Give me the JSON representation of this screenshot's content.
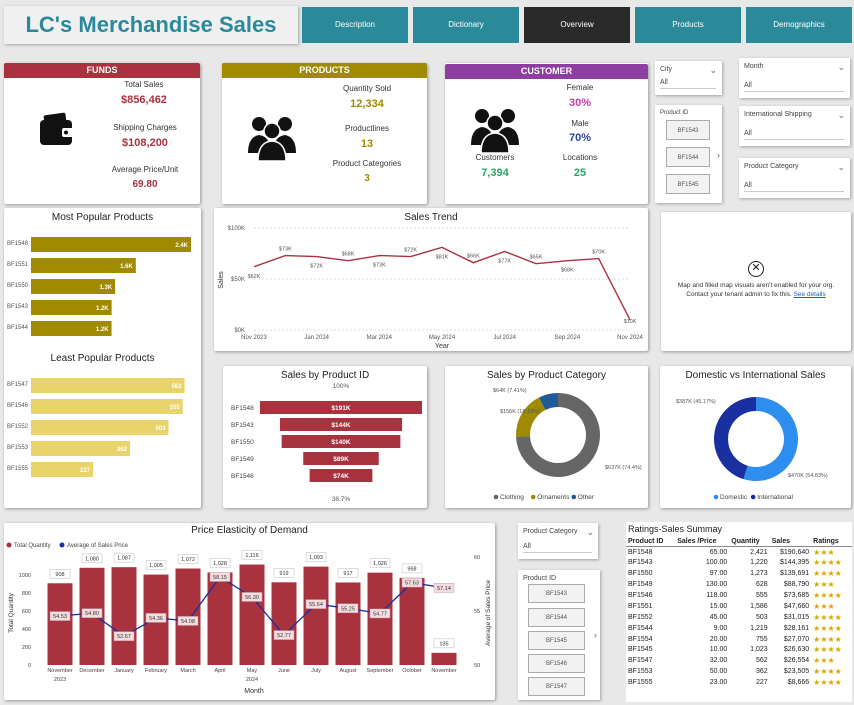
{
  "app_title": "LC's Merchandise Sales",
  "tabs": [
    {
      "label": "Description"
    },
    {
      "label": "Dictionary"
    },
    {
      "label": "Overview"
    },
    {
      "label": "Products"
    },
    {
      "label": "Demographics"
    }
  ],
  "colors": {
    "teal": "#2b8a9a",
    "funds": "#a8323e",
    "products": "#a08a00",
    "customer": "#8e3da0",
    "maroon": "#a8323e"
  },
  "funds": {
    "header": "FUNDS",
    "total_sales_label": "Total Sales",
    "total_sales": "$856,462",
    "shipping_label": "Shipping Charges",
    "shipping": "$108,200",
    "avg_price_label": "Average Price/Unit",
    "avg_price": "69.80",
    "icon": "wallet-icon"
  },
  "products": {
    "header": "PRODUCTS",
    "qty_label": "Quantity Sold",
    "qty": "12,334",
    "lines_label": "Productlines",
    "lines": "13",
    "cats_label": "Product Categories",
    "cats": "3",
    "icon": "people-group-icon"
  },
  "customer": {
    "header": "CUSTOMER",
    "female_label": "Female",
    "female": "30%",
    "male_label": "Male",
    "male": "70%",
    "customers_label": "Customers",
    "customers": "7,394",
    "locations_label": "Locations",
    "locations": "25",
    "icon": "people-group-icon"
  },
  "slicers": {
    "city": {
      "label": "City",
      "value": "All"
    },
    "month": {
      "label": "Month",
      "value": "All"
    },
    "product_id": {
      "label": "Product ID",
      "items": [
        "BF1543",
        "BF1544",
        "BF1545"
      ]
    },
    "intl_shipping": {
      "label": "International Shipping",
      "value": "All"
    },
    "product_category": {
      "label": "Product Category",
      "value": "All"
    },
    "product_category2": {
      "label": "Product Category",
      "value": "All"
    },
    "product_id2": {
      "label": "Product ID",
      "items": [
        "BF1543",
        "BF1544",
        "BF1545",
        "BF1546",
        "BF1547"
      ]
    }
  },
  "map_notice": {
    "text": "Map and filled map visuals aren't enabled for your org. Contact your tenant admin to fix this.",
    "link": "See details"
  },
  "ratings_table": {
    "title": "Ratings-Sales Summay",
    "headers": [
      "Product ID",
      "Sales /Price",
      "Quantity",
      "Sales",
      "Ratings"
    ],
    "rows": [
      [
        "BF1548",
        "65.00",
        "2,421",
        "$190,640",
        "★★★"
      ],
      [
        "BF1543",
        "100.00",
        "1,220",
        "$144,395",
        "★★★★"
      ],
      [
        "BF1550",
        "97.00",
        "1,273",
        "$139,691",
        "★★★★"
      ],
      [
        "BF1549",
        "130.00",
        "628",
        "$88,790",
        "★★★"
      ],
      [
        "BF1546",
        "118.00",
        "555",
        "$73,685",
        "★★★★"
      ],
      [
        "BF1551",
        "15.00",
        "1,586",
        "$47,660",
        "★★★"
      ],
      [
        "BF1552",
        "45.00",
        "503",
        "$31,015",
        "★★★★"
      ],
      [
        "BF1544",
        "9.00",
        "1,219",
        "$28,161",
        "★★★★"
      ],
      [
        "BF1554",
        "20.00",
        "755",
        "$27,070",
        "★★★★"
      ],
      [
        "BF1545",
        "10.00",
        "1,023",
        "$26,630",
        "★★★★"
      ],
      [
        "BF1547",
        "32.00",
        "562",
        "$26,554",
        "★★★"
      ],
      [
        "BF1553",
        "50.00",
        "362",
        "$23,505",
        "★★★★"
      ],
      [
        "BF1555",
        "23.00",
        "227",
        "$8,666",
        "★★★★"
      ]
    ]
  },
  "chart_data": [
    {
      "id": "most_popular",
      "type": "bar",
      "title": "Most Popular Products",
      "categories": [
        "BF1548",
        "BF1551",
        "BF1550",
        "BF1543",
        "BF1544"
      ],
      "values": [
        2421,
        1586,
        1273,
        1220,
        1219
      ],
      "labels": [
        "2.4K",
        "1.6K",
        "1.3K",
        "1.2K",
        "1.2K"
      ]
    },
    {
      "id": "least_popular",
      "type": "bar",
      "title": "Least Popular Products",
      "categories": [
        "BF1547",
        "BF1546",
        "BF1552",
        "BF1553",
        "BF1555"
      ],
      "values": [
        562,
        555,
        503,
        362,
        227
      ],
      "labels": [
        "562",
        "555",
        "503",
        "362",
        "227"
      ]
    },
    {
      "id": "sales_trend",
      "type": "line",
      "title": "Sales Trend",
      "xlabel": "Year",
      "ylabel": "Sales",
      "x": [
        "Nov 2023",
        "Dec 2023",
        "Jan 2024",
        "Feb 2024",
        "Mar 2024",
        "Apr 2024",
        "May 2024",
        "Jun 2024",
        "Jul 2024",
        "Aug 2024",
        "Sep 2024",
        "Oct 2024",
        "Nov 2024"
      ],
      "values": [
        62,
        73,
        72,
        68,
        73,
        72,
        81,
        66,
        77,
        65,
        68,
        70,
        10
      ],
      "labels": [
        "$62K",
        "$73K",
        "$72K",
        "$68K",
        "$73K",
        "$72K",
        "$81K",
        "$66K",
        "$77K",
        "$65K",
        "$68K",
        "$70K",
        "$10K"
      ],
      "xticks": [
        "Nov 2023",
        "Jan 2024",
        "Mar 2024",
        "May 2024",
        "Jul 2024",
        "Sep 2024",
        "Nov 2024"
      ],
      "yticks": [
        "$100K",
        "$50K",
        "$0K"
      ],
      "ylim": [
        0,
        100
      ]
    },
    {
      "id": "sales_by_product",
      "type": "bar",
      "title": "Sales by Product ID",
      "categories": [
        "BF1548",
        "BF1543",
        "BF1550",
        "BF1549",
        "BF1546"
      ],
      "values": [
        191,
        144,
        140,
        89,
        74
      ],
      "labels": [
        "$191K",
        "$144K",
        "$140K",
        "$89K",
        "$74K"
      ],
      "top_pct": "100%",
      "bottom_pct": "38.7%"
    },
    {
      "id": "sales_by_category",
      "type": "pie",
      "title": "Sales by Product Category",
      "series": [
        {
          "name": "Clothing",
          "value": 637,
          "label": "$637K (74.4%)",
          "color": "#666666"
        },
        {
          "name": "Ornaments",
          "value": 156,
          "label": "$156K (18.19%)",
          "color": "#a08a00"
        },
        {
          "name": "Other",
          "value": 64,
          "label": "$64K (7.41%)",
          "color": "#1f5a9a"
        }
      ]
    },
    {
      "id": "domestic_intl",
      "type": "pie",
      "title": "Domestic vs International Sales",
      "series": [
        {
          "name": "Domestic",
          "value": 470,
          "label": "$470K (54.83%)",
          "color": "#2e8ef0"
        },
        {
          "name": "International",
          "value": 387,
          "label": "$387K (45.17%)",
          "color": "#1a2fa0"
        }
      ]
    },
    {
      "id": "price_elasticity",
      "type": "bar",
      "title": "Price Elasticity of Demand",
      "xlabel": "Month",
      "ylabel": "Total Quantity",
      "y2label": "Average of Sales Price",
      "legend": [
        "Total Quantity",
        "Average of Sales Price"
      ],
      "categories": [
        "November",
        "December",
        "January",
        "February",
        "March",
        "April",
        "May",
        "June",
        "July",
        "August",
        "September",
        "October",
        "November"
      ],
      "year_labels": {
        "0": "2023",
        "6": "2024"
      },
      "quantity": [
        908,
        1080,
        1087,
        1005,
        1072,
        1028,
        1116,
        919,
        1093,
        917,
        1026,
        968,
        135
      ],
      "avg_price": [
        54.53,
        54.8,
        52.67,
        54.36,
        54.08,
        58.15,
        56.3,
        52.77,
        55.64,
        55.25,
        54.77,
        57.63,
        57.14
      ],
      "price_labels": [
        "54.53",
        "54.80",
        "52.67",
        "54.36",
        "54.08",
        "58.15",
        "56.30",
        "52.77",
        "55.64",
        "55.25",
        "54.77",
        "57.63",
        "57.14"
      ],
      "y2ticks": [
        "60",
        "55",
        "50"
      ]
    }
  ]
}
